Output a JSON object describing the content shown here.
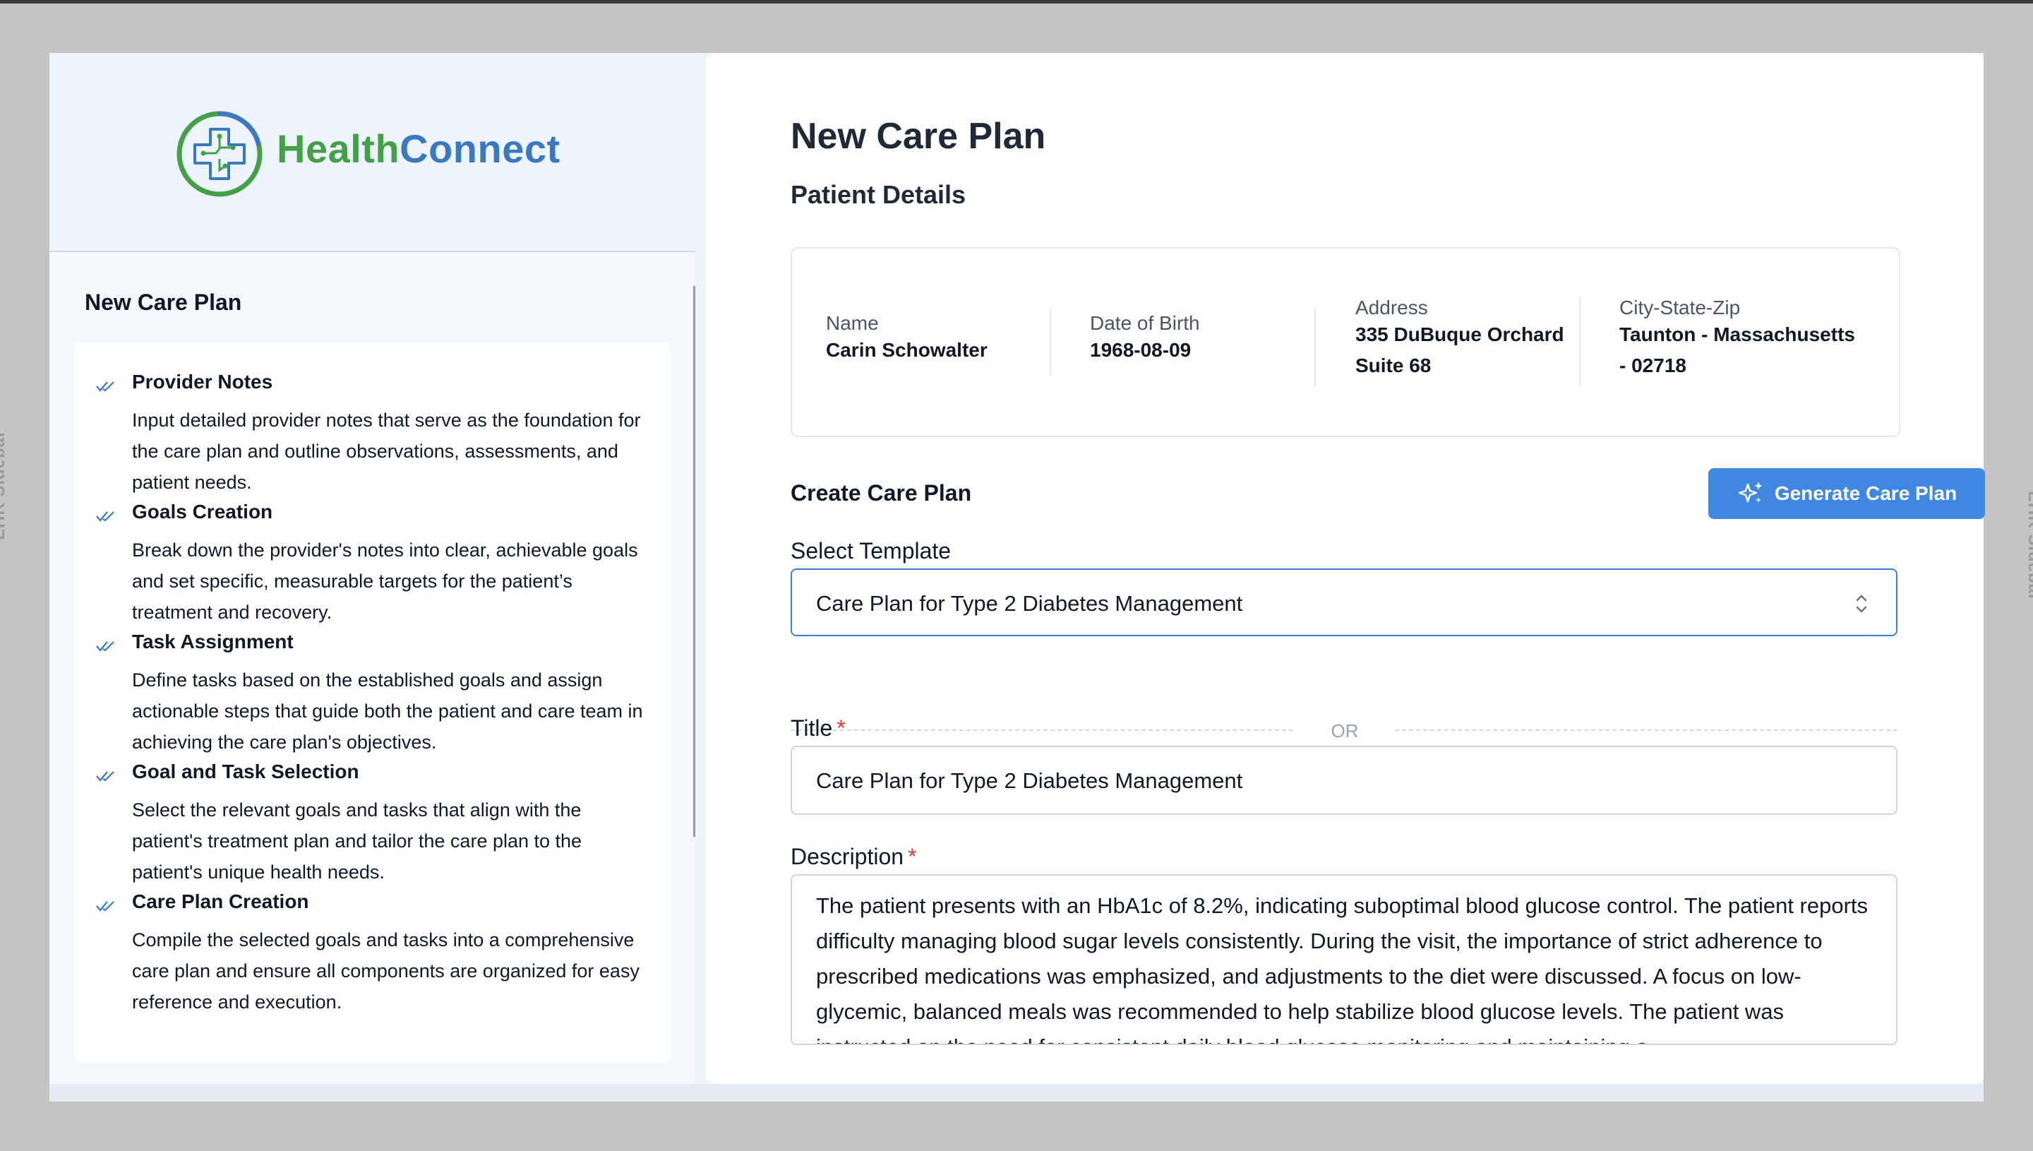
{
  "frame": {
    "left_sidebar_label": "EHR Sidebar",
    "right_sidebar_label": "EHR Sidebar"
  },
  "brand": {
    "name_part1": "Health",
    "name_part2": "Connect",
    "color_green": "#43a047",
    "color_blue": "#3a78c2"
  },
  "sidebar": {
    "title": "New Care Plan",
    "steps": [
      {
        "title": "Provider Notes",
        "description": "Input detailed provider notes that serve as the foundation for the care plan and outline observations, assessments, and patient needs.",
        "icon": "check-icon"
      },
      {
        "title": "Goals Creation",
        "description": "Break down the provider's notes into clear, achievable goals and set specific, measurable targets for the patient’s treatment and recovery.",
        "icon": "check-icon"
      },
      {
        "title": "Task Assignment",
        "description": "Define tasks based on the established goals and assign actionable steps that guide both the patient and care team in achieving the care plan's objectives.",
        "icon": "check-icon"
      },
      {
        "title": "Goal and Task Selection",
        "description": "Select the relevant goals and tasks that align with the patient's treatment plan and tailor the care plan to the patient's unique health needs.",
        "icon": "check-icon"
      },
      {
        "title": "Care Plan Creation",
        "description": "Compile the selected goals and tasks into a comprehensive care plan and ensure all components are organized for easy reference and execution.",
        "icon": "check-icon"
      }
    ]
  },
  "main": {
    "page_title": "New Care Plan",
    "patient_section_title": "Patient Details",
    "patient": {
      "name_label": "Name",
      "name_value": "Carin Schowalter",
      "dob_label": "Date of Birth",
      "dob_value": "1968-08-09",
      "address_label": "Address",
      "address_line1": "335 DuBuque Orchard",
      "address_line2": "Suite 68",
      "csz_label": "City-State-Zip",
      "csz_line1": "Taunton - Massachusetts",
      "csz_line2": "- 02718"
    },
    "create_title": "Create Care Plan",
    "generate_button": "Generate Care Plan",
    "template_label": "Select Template",
    "template_value": "Care Plan for Type 2 Diabetes Management",
    "or_text": "OR",
    "title_label": "Title",
    "title_required": "*",
    "title_value": "Care Plan for Type 2 Diabetes Management",
    "description_label": "Description",
    "description_required": "*",
    "description_value": "The patient presents with an HbA1c of 8.2%, indicating suboptimal blood glucose control. The patient reports difficulty managing blood sugar levels consistently. During the visit, the importance of strict adherence to prescribed medications was emphasized, and adjustments to the diet were discussed. A focus on low-glycemic, balanced meals was recommended to help stabilize blood glucose levels. The patient was instructed on the need for consistent daily blood glucose monitoring and maintaining a",
    "accent_color": "#3f87e0"
  }
}
